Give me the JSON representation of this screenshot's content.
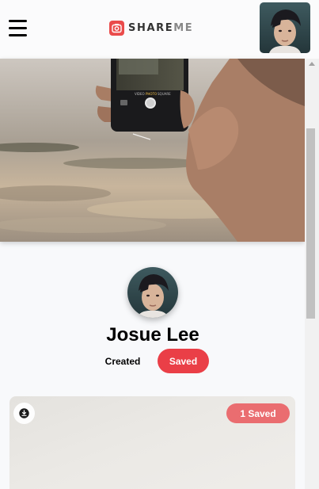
{
  "header": {
    "logo_text": "SHARE",
    "logo_text_accent": "ME",
    "menu_icon": "hamburger-menu-icon",
    "logo_icon": "camera-icon"
  },
  "banner": {
    "image_subject": "hand holding smartphone camera over beach at sunset",
    "phone_mode_labels": [
      "VIDEO",
      "PHOTO",
      "SQUARE"
    ]
  },
  "profile": {
    "name": "Josue Lee",
    "tabs": [
      {
        "label": "Created",
        "active": false
      },
      {
        "label": "Saved",
        "active": true
      }
    ]
  },
  "pins": [
    {
      "saved_label": "1 Saved",
      "download_icon": "download-icon"
    }
  ],
  "colors": {
    "accent": "#ea3f47",
    "saved_badge": "#ea6d70",
    "background": "#f8f9fb"
  }
}
